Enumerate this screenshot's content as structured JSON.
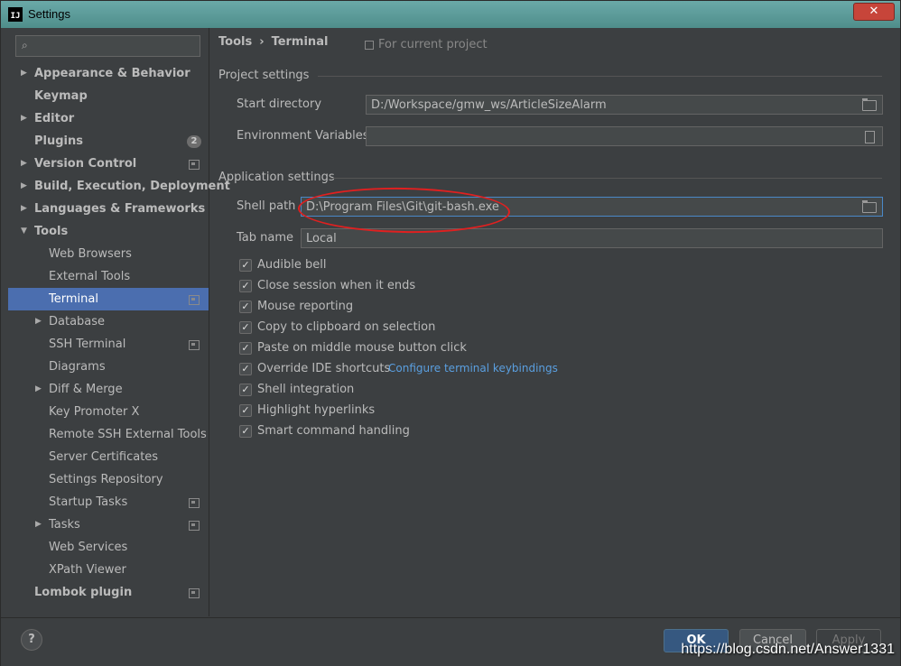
{
  "window": {
    "title": "Settings",
    "icon_text": "IJ"
  },
  "search": {
    "placeholder": ""
  },
  "sidebar": {
    "items": [
      {
        "label": "Appearance & Behavior",
        "level": 0,
        "arrow": "right",
        "bold": true
      },
      {
        "label": "Keymap",
        "level": 0,
        "arrow": "",
        "bold": true
      },
      {
        "label": "Editor",
        "level": 0,
        "arrow": "right",
        "bold": true
      },
      {
        "label": "Plugins",
        "level": 0,
        "arrow": "",
        "bold": true,
        "badge": "2"
      },
      {
        "label": "Version Control",
        "level": 0,
        "arrow": "right",
        "bold": true,
        "project": true
      },
      {
        "label": "Build, Execution, Deployment",
        "level": 0,
        "arrow": "right",
        "bold": true
      },
      {
        "label": "Languages & Frameworks",
        "level": 0,
        "arrow": "right",
        "bold": true
      },
      {
        "label": "Tools",
        "level": 0,
        "arrow": "down",
        "bold": true
      },
      {
        "label": "Web Browsers",
        "level": 1,
        "arrow": ""
      },
      {
        "label": "External Tools",
        "level": 1,
        "arrow": ""
      },
      {
        "label": "Terminal",
        "level": 1,
        "arrow": "",
        "selected": true,
        "project": true
      },
      {
        "label": "Database",
        "level": 1,
        "arrow": "right"
      },
      {
        "label": "SSH Terminal",
        "level": 1,
        "arrow": "",
        "project": true
      },
      {
        "label": "Diagrams",
        "level": 1,
        "arrow": ""
      },
      {
        "label": "Diff & Merge",
        "level": 1,
        "arrow": "right"
      },
      {
        "label": "Key Promoter X",
        "level": 1,
        "arrow": ""
      },
      {
        "label": "Remote SSH External Tools",
        "level": 1,
        "arrow": ""
      },
      {
        "label": "Server Certificates",
        "level": 1,
        "arrow": ""
      },
      {
        "label": "Settings Repository",
        "level": 1,
        "arrow": ""
      },
      {
        "label": "Startup Tasks",
        "level": 1,
        "arrow": "",
        "project": true
      },
      {
        "label": "Tasks",
        "level": 1,
        "arrow": "right",
        "project": true
      },
      {
        "label": "Web Services",
        "level": 1,
        "arrow": ""
      },
      {
        "label": "XPath Viewer",
        "level": 1,
        "arrow": ""
      },
      {
        "label": "Lombok plugin",
        "level": 0,
        "arrow": "",
        "bold": true,
        "project": true
      }
    ]
  },
  "breadcrumb": {
    "parent": "Tools",
    "separator": "›",
    "current": "Terminal",
    "scope": "For current project"
  },
  "project_settings": {
    "title": "Project settings",
    "start_directory_label": "Start directory",
    "start_directory_value": "D:/Workspace/gmw_ws/ArticleSizeAlarm",
    "env_vars_label": "Environment Variables",
    "env_vars_value": ""
  },
  "application_settings": {
    "title": "Application settings",
    "shell_path_label": "Shell path",
    "shell_path_value": "D:\\Program Files\\Git\\git-bash.exe",
    "tab_name_label": "Tab name",
    "tab_name_value": "Local"
  },
  "checkboxes": [
    {
      "label": "Audible bell",
      "checked": true
    },
    {
      "label": "Close session when it ends",
      "checked": true
    },
    {
      "label": "Mouse reporting",
      "checked": true
    },
    {
      "label": "Copy to clipboard on selection",
      "checked": true
    },
    {
      "label": "Paste on middle mouse button click",
      "checked": true
    },
    {
      "label": "Override IDE shortcuts",
      "checked": true
    },
    {
      "label": "Shell integration",
      "checked": true
    },
    {
      "label": "Highlight hyperlinks",
      "checked": true
    },
    {
      "label": "Smart command handling",
      "checked": true
    }
  ],
  "keybindings_link": "Configure terminal keybindings",
  "buttons": {
    "help": "?",
    "ok": "OK",
    "cancel": "Cancel",
    "apply": "Apply"
  },
  "watermark": "https://blog.csdn.net/Answer1331",
  "colors": {
    "selection": "#4b6eaf",
    "link": "#5a9fe0",
    "highlight_ellipse": "#e02020",
    "ok_button": "#365880"
  }
}
